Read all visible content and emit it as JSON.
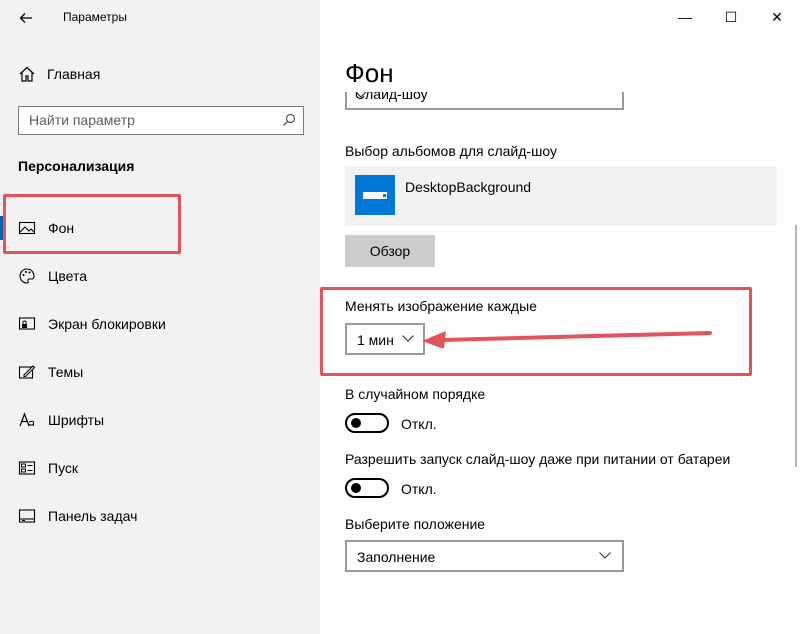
{
  "window": {
    "title": "Параметры",
    "back_icon": "arrow-left-icon",
    "minimize_glyph": "—",
    "maximize_glyph": "☐",
    "close_glyph": "✕"
  },
  "sidebar": {
    "home_label": "Главная",
    "search_placeholder": "Найти параметр",
    "section_title": "Персонализация",
    "items": [
      {
        "label": "Фон",
        "icon": "picture-icon",
        "active": true
      },
      {
        "label": "Цвета",
        "icon": "palette-icon"
      },
      {
        "label": "Экран блокировки",
        "icon": "lock-screen-icon"
      },
      {
        "label": "Темы",
        "icon": "themes-icon"
      },
      {
        "label": "Шрифты",
        "icon": "font-icon"
      },
      {
        "label": "Пуск",
        "icon": "start-icon"
      },
      {
        "label": "Панель задач",
        "icon": "taskbar-icon"
      }
    ]
  },
  "main": {
    "title": "Фон",
    "background_select_value": "Слайд-шоу",
    "albums_label": "Выбор альбомов для слайд-шоу",
    "album_name": "DesktopBackground",
    "browse_button": "Обзор",
    "change_every_label": "Менять изображение каждые",
    "change_every_value": "1 мин",
    "shuffle_label": "В случайном порядке",
    "shuffle_state": "Откл.",
    "battery_label": "Разрешить запуск слайд-шоу даже при питании от батареи",
    "battery_state": "Откл.",
    "position_label": "Выберите положение",
    "position_value": "Заполнение"
  },
  "colors": {
    "accent": "#0078d7",
    "highlight": "#e25457",
    "sidebar_bg": "#f2f2f2"
  }
}
